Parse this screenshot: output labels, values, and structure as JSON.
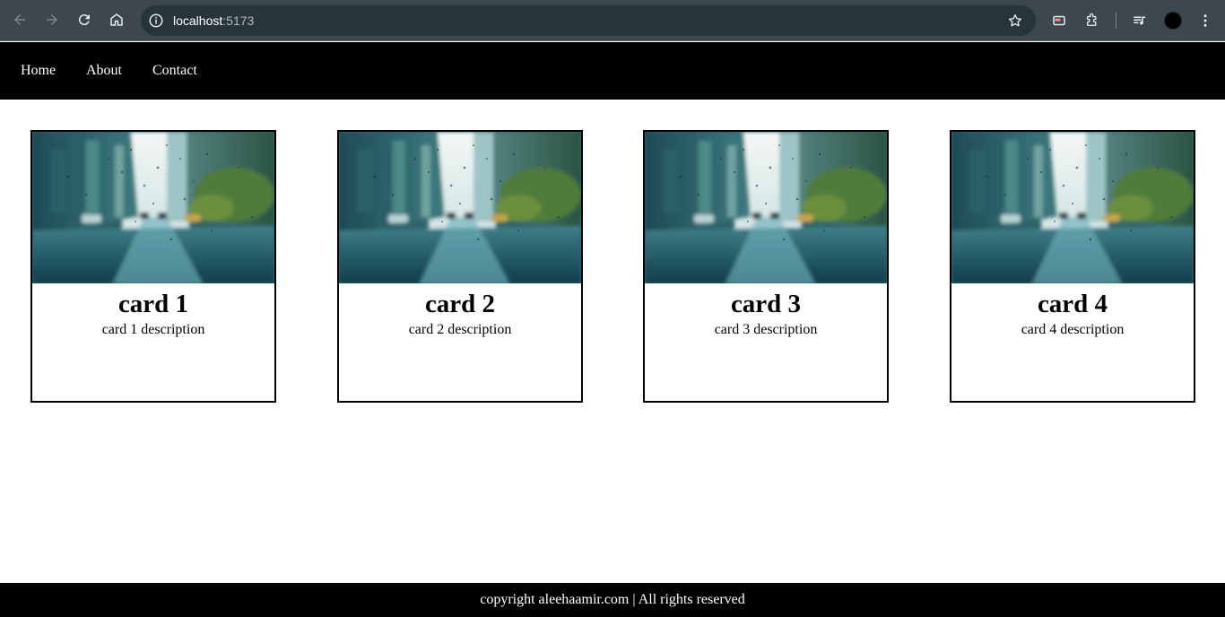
{
  "browser": {
    "url_host": "localhost",
    "url_port": ":5173"
  },
  "nav": {
    "links": [
      {
        "label": "Home"
      },
      {
        "label": "About"
      },
      {
        "label": "Contact"
      }
    ]
  },
  "cards": [
    {
      "title": "card 1",
      "description": "card 1 description"
    },
    {
      "title": "card 2",
      "description": "card 2 description"
    },
    {
      "title": "card 3",
      "description": "card 3 description"
    },
    {
      "title": "card 4",
      "description": "card 4 description"
    }
  ],
  "footer": {
    "text": "copyright aleehaamir.com | All rights reserved"
  },
  "colors": {
    "chrome_bg": "#3c474e",
    "omnibox_bg": "#28343b",
    "nav_bg": "#000000",
    "footer_bg": "#000000",
    "card_border": "#000000"
  }
}
